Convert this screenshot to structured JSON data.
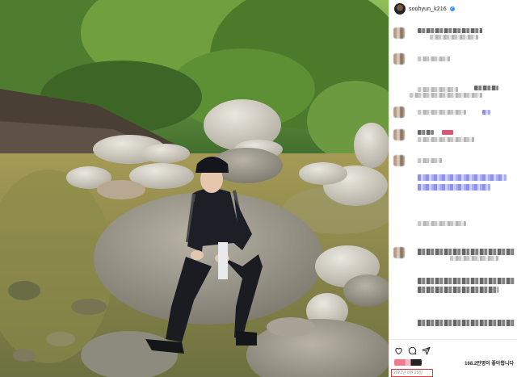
{
  "post": {
    "username": "soohyun_k216",
    "verified_glyph": "✓",
    "likes_text": "168.2만명이 좋아합니다",
    "date_text": "2022년 8월 29일"
  },
  "icons": [
    "heart-icon",
    "comment-icon",
    "share-icon"
  ],
  "colors": {
    "date_highlight": "#e23b3b",
    "verified": "#3897f0"
  }
}
